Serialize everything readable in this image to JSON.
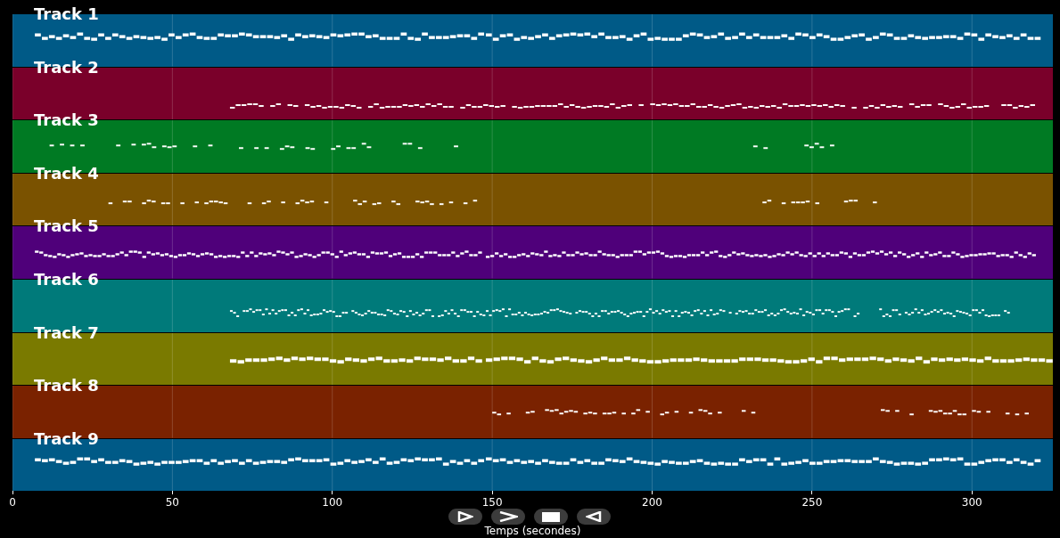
{
  "chart": {
    "tracks": [
      {
        "name": "Track 1",
        "color": "#005a87"
      },
      {
        "name": "Track 2",
        "color": "#7a002a"
      },
      {
        "name": "Track 3",
        "color": "#007a23"
      },
      {
        "name": "Track 4",
        "color": "#7a5200"
      },
      {
        "name": "Track 5",
        "color": "#4f007a"
      },
      {
        "name": "Track 6",
        "color": "#007a7a"
      },
      {
        "name": "Track 7",
        "color": "#7a7a00"
      },
      {
        "name": "Track 8",
        "color": "#7a2200"
      },
      {
        "name": "Track 9",
        "color": "#005a87"
      }
    ],
    "x_ticks": [
      "0",
      "50",
      "100",
      "150",
      "200",
      "250",
      "300"
    ],
    "xlabel": "Temps (secondes)"
  },
  "controls": [
    {
      "kind": "play"
    },
    {
      "kind": "forward"
    },
    {
      "kind": "stop"
    },
    {
      "kind": "back"
    }
  ]
}
